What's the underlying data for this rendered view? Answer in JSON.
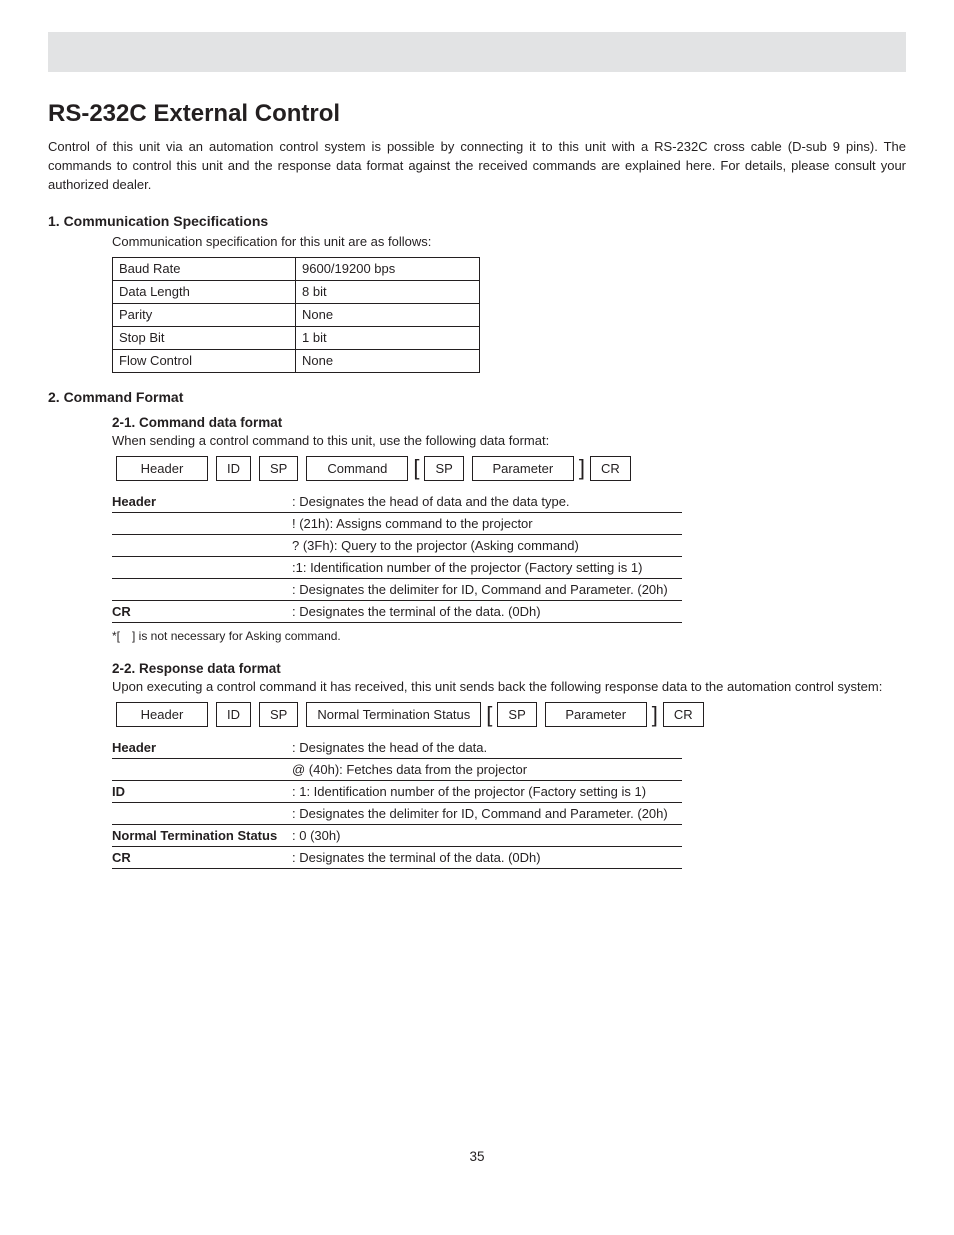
{
  "title": "RS-232C External Control",
  "intro": "Control of this unit via an automation control system is possible by connecting it to this unit with a RS-232C cross cable (D-sub 9 pins). The commands to control this unit and the response data format against the received commands are explained here. For details, please consult your authorized dealer.",
  "section1": {
    "heading": "1. Communication Specifications",
    "body": "Communication specification for this unit are as follows:",
    "rows": [
      {
        "k": "Baud Rate",
        "v": "9600/19200 bps"
      },
      {
        "k": "Data Length",
        "v": "8 bit"
      },
      {
        "k": "Parity",
        "v": "None"
      },
      {
        "k": "Stop Bit",
        "v": "1 bit"
      },
      {
        "k": "Flow Control",
        "v": "None"
      }
    ]
  },
  "section2": {
    "heading": "2. Command Format",
    "sub1": {
      "heading": "2-1. Command data format",
      "body": "When sending a control command to this unit, use the following data format:",
      "tokens": [
        "Header",
        "ID",
        "SP",
        "Command",
        "[",
        "SP",
        "Parameter",
        "]",
        "CR"
      ],
      "defs": [
        {
          "term": "Header",
          "desc": ": Designates the head of data and the data type."
        },
        {
          "term": "",
          "desc": "! (21h): Assigns command to the projector"
        },
        {
          "term": "",
          "desc": "? (3Fh): Query to the projector (Asking command)"
        },
        {
          "term": "",
          "desc": ":1: Identification number of the projector (Factory setting is 1)"
        },
        {
          "term": "",
          "desc": ": Designates the delimiter for ID, Command and Parameter. (20h)"
        },
        {
          "term": "CR",
          "desc": ": Designates the terminal of the data. (0Dh)"
        }
      ],
      "footnote": "*[ ] is not necessary for Asking command."
    },
    "sub2": {
      "heading": "2-2. Response data format",
      "body": "Upon executing a control command it has received, this unit sends back the following response data to the automation control system:",
      "tokens": [
        "Header",
        "ID",
        "SP",
        "Normal Termination Status",
        "[",
        "SP",
        "Parameter",
        "]",
        "CR"
      ],
      "defs": [
        {
          "term": "Header",
          "desc": ": Designates the head of the data."
        },
        {
          "term": "",
          "desc": "@ (40h): Fetches data from the projector"
        },
        {
          "term": "ID",
          "desc": ": 1: Identification number of the projector (Factory setting is 1)"
        },
        {
          "term": "",
          "desc": ": Designates the delimiter for ID, Command and Parameter. (20h)"
        },
        {
          "term": "Normal Termination Status",
          "desc": ": 0 (30h)"
        },
        {
          "term": "CR",
          "desc": ": Designates the terminal of the data. (0Dh)"
        }
      ]
    }
  },
  "pageNumber": "35"
}
